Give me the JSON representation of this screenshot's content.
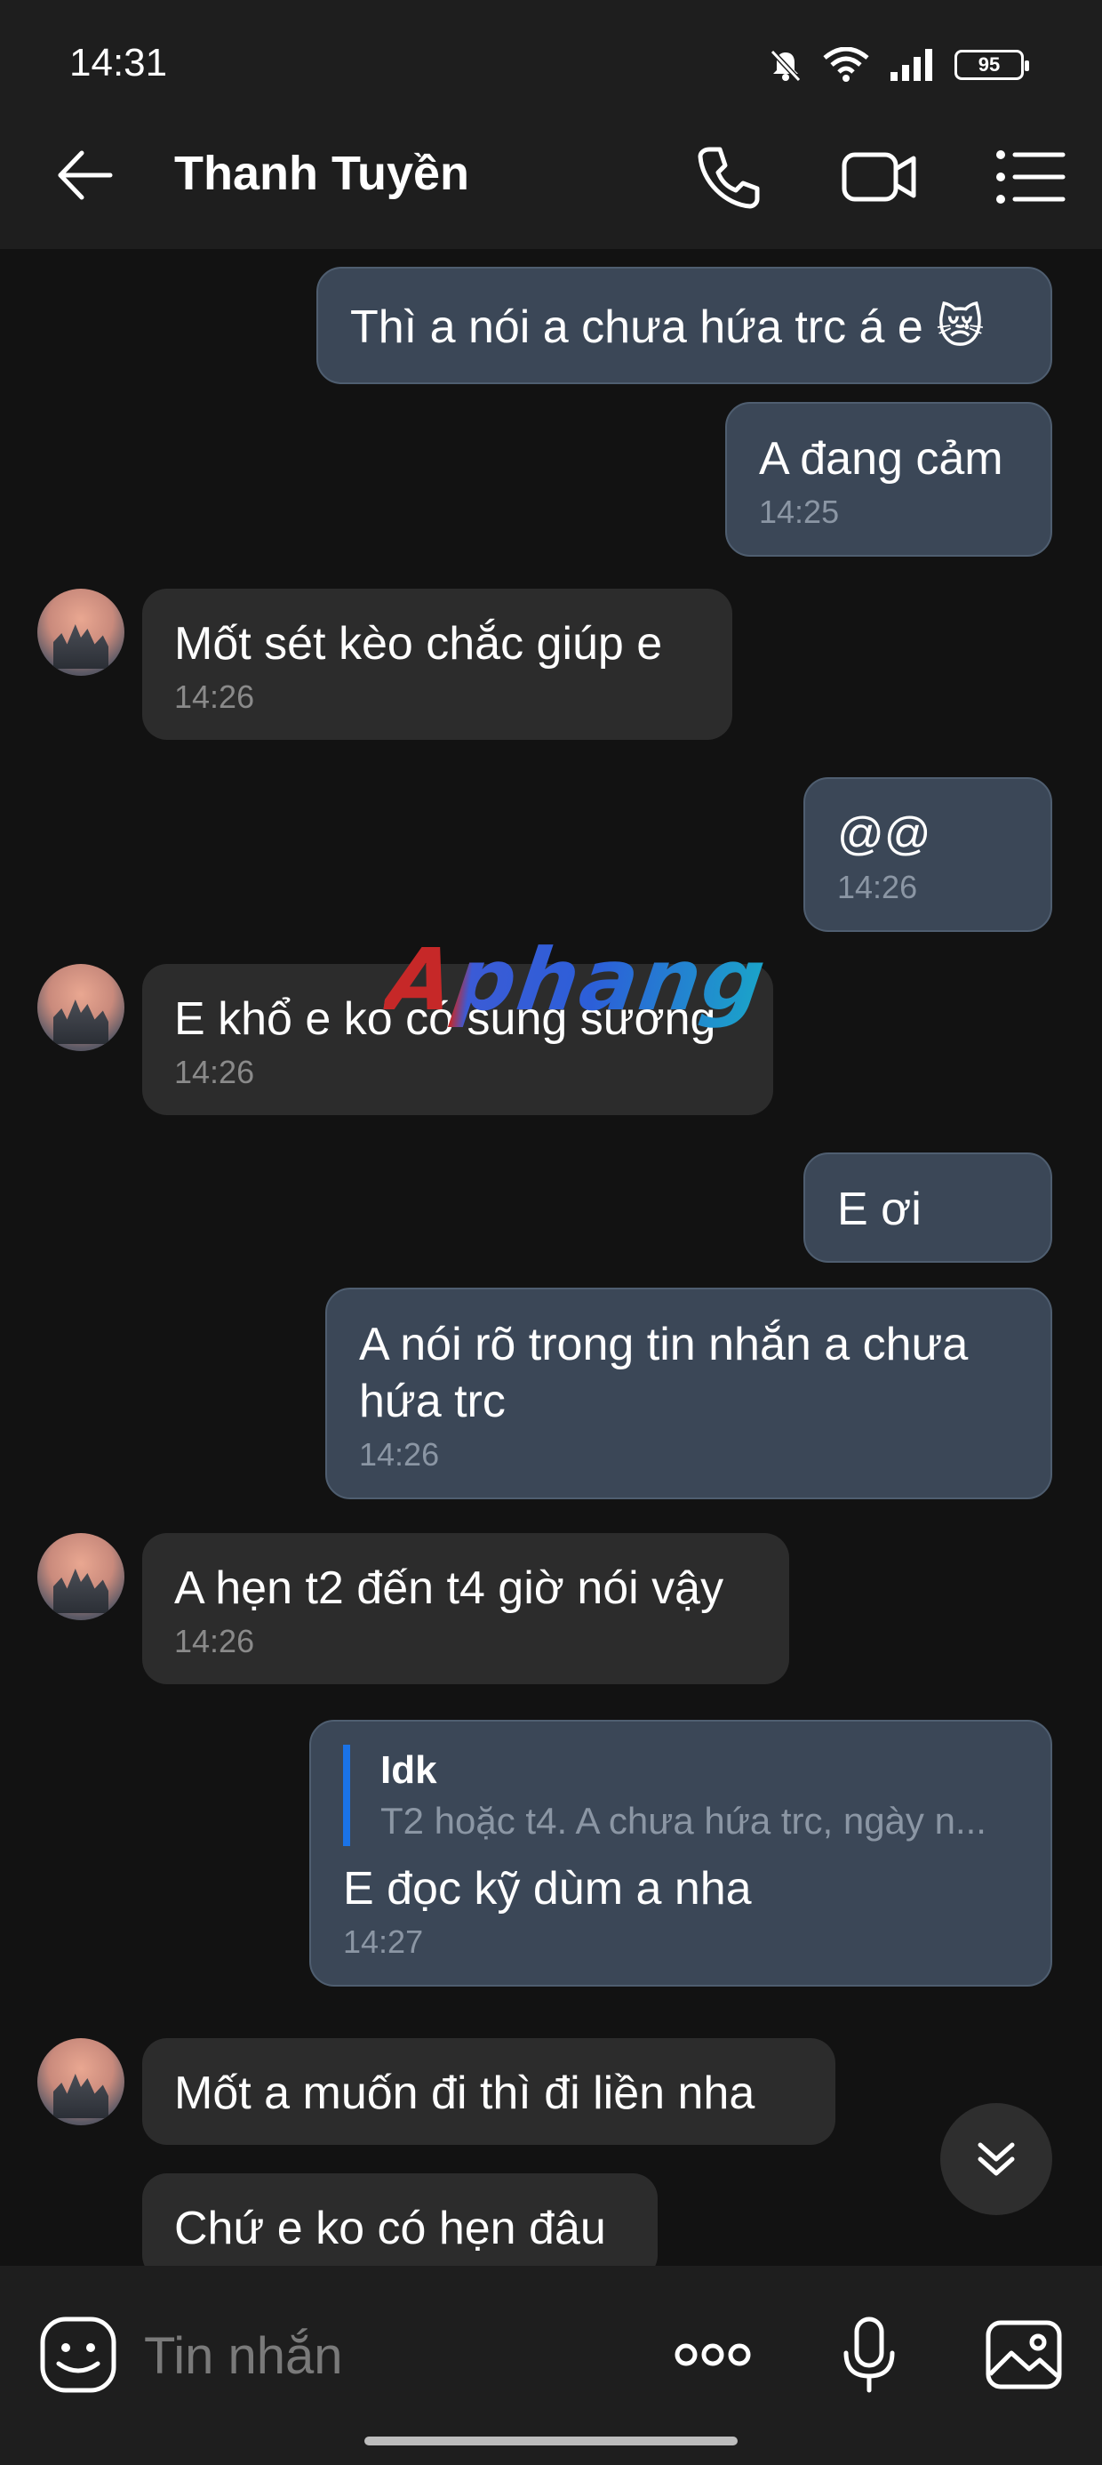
{
  "status_bar": {
    "time": "14:31",
    "battery": "95"
  },
  "header": {
    "title": "Thanh Tuyền",
    "back_icon": "arrow-left-icon",
    "call_icon": "phone-icon",
    "video_icon": "video-camera-icon",
    "menu_icon": "list-menu-icon"
  },
  "messages": [
    {
      "side": "me",
      "text": "Thì a nói a chưa hứa trc á e 😿",
      "time": ""
    },
    {
      "side": "me",
      "text": "A đang cảm",
      "time": "14:25"
    },
    {
      "side": "them",
      "text": "Mốt sét kèo chắc giúp e",
      "time": "14:26"
    },
    {
      "side": "me",
      "text": "@@",
      "time": "14:26"
    },
    {
      "side": "them",
      "text": "E khổ e ko có sung sướng",
      "time": "14:26"
    },
    {
      "side": "me",
      "text": "E ơi",
      "time": ""
    },
    {
      "side": "me",
      "text": "A nói rõ trong tin nhắn a chưa hứa trc",
      "time": "14:26"
    },
    {
      "side": "them",
      "text": "A hẹn t2 đến t4 giờ nói vậy",
      "time": "14:26"
    },
    {
      "side": "me",
      "reply_name": "Idk",
      "reply_text": "T2 hoặc t4. A chưa hứa trc, ngày n...",
      "text": "E đọc kỹ dùm a nha",
      "time": "14:27"
    },
    {
      "side": "them",
      "text": "Mốt a muốn đi thì đi liền nha",
      "time": ""
    },
    {
      "side": "them",
      "text": "Chứ e ko có hẹn đâu",
      "time": ""
    }
  ],
  "watermark": "Aphang",
  "composer": {
    "placeholder": "Tin nhắn",
    "emoji_icon": "emoji-sticker-icon",
    "more_icon": "more-dots-icon",
    "mic_icon": "microphone-icon",
    "image_icon": "image-icon"
  },
  "colors": {
    "background": "#121212",
    "my_bubble": "#3b4757",
    "their_bubble": "#2c2c2c",
    "reply_accent": "#1a73e8"
  }
}
